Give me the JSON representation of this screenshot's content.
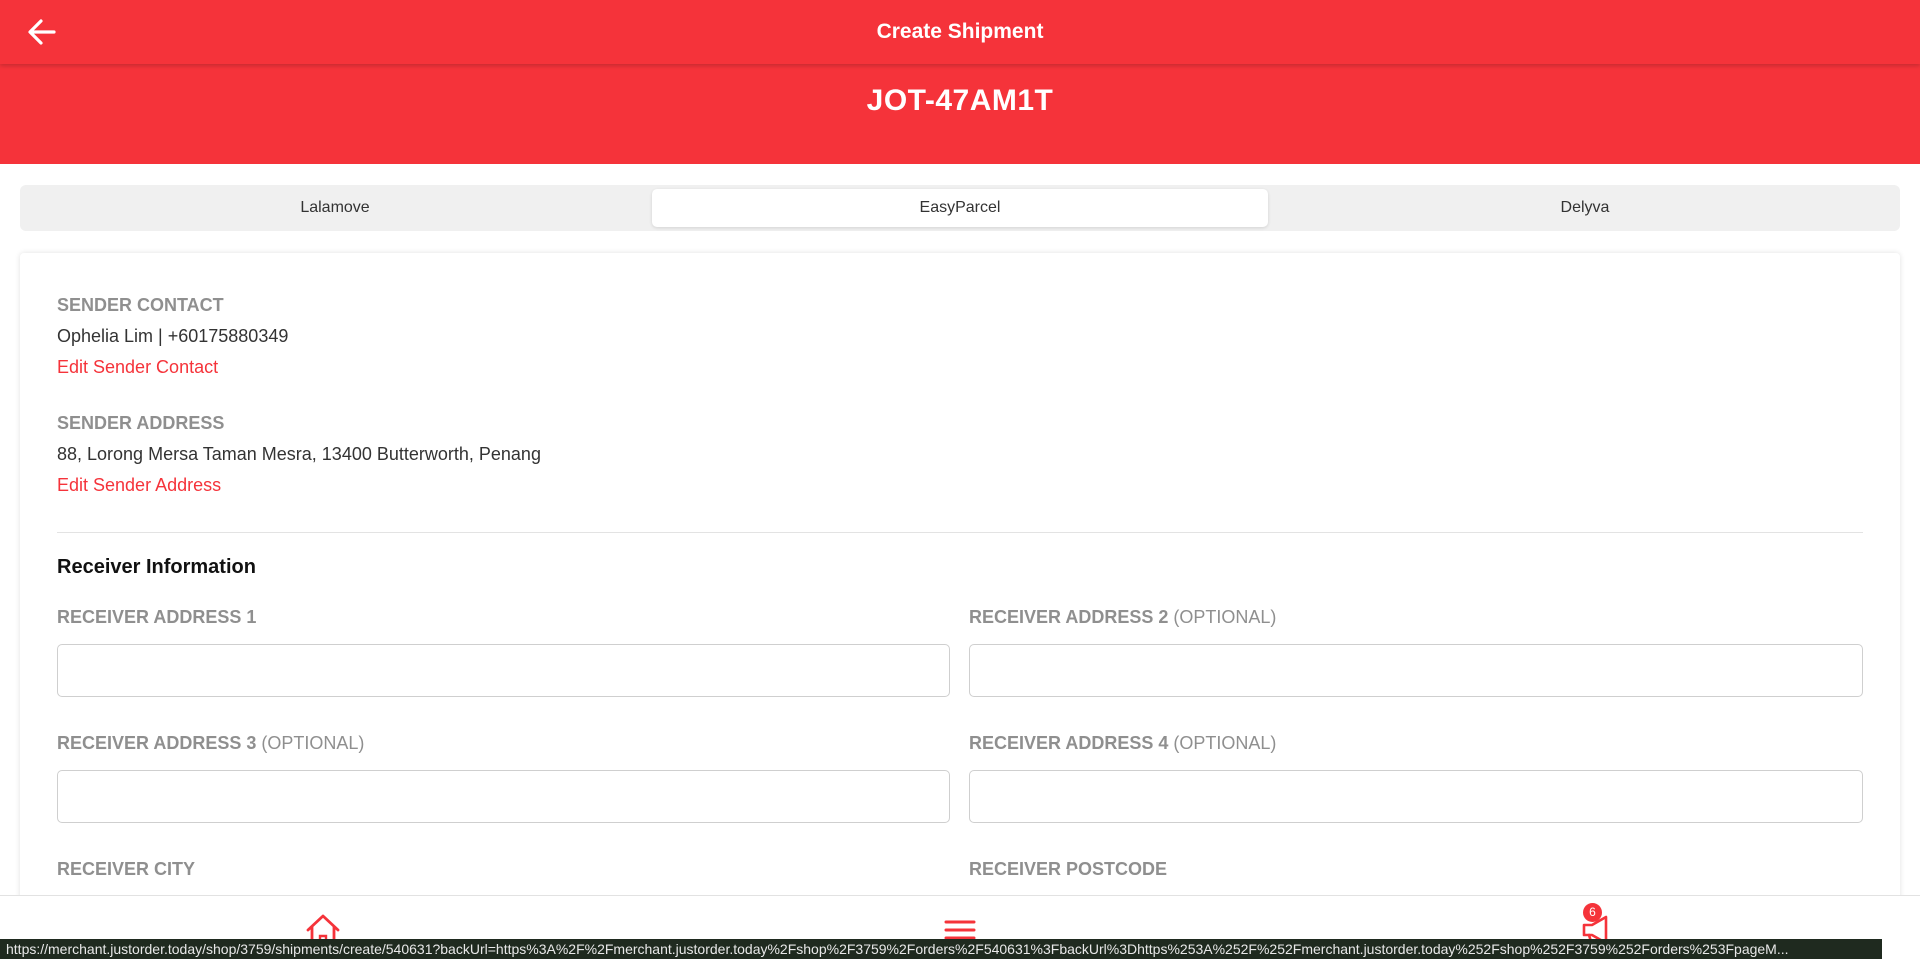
{
  "header": {
    "title": "Create Shipment",
    "order_code": "JOT-47AM1T"
  },
  "tabs": [
    {
      "label": "Lalamove",
      "active": false
    },
    {
      "label": "EasyParcel",
      "active": true
    },
    {
      "label": "Delyva",
      "active": false
    }
  ],
  "sender": {
    "contact_label": "SENDER CONTACT",
    "contact_value": "Ophelia Lim | +60175880349",
    "edit_contact_link": "Edit Sender Contact",
    "address_label": "SENDER ADDRESS",
    "address_value": "88, Lorong Mersa Taman Mesra, 13400 Butterworth, Penang",
    "edit_address_link": "Edit Sender Address"
  },
  "receiver": {
    "section_title": "Receiver Information",
    "address1": {
      "label": "RECEIVER ADDRESS 1",
      "optional": "",
      "value": ""
    },
    "address2": {
      "label": "RECEIVER ADDRESS 2",
      "optional": "(OPTIONAL)",
      "value": ""
    },
    "address3": {
      "label": "RECEIVER ADDRESS 3",
      "optional": "(OPTIONAL)",
      "value": ""
    },
    "address4": {
      "label": "RECEIVER ADDRESS 4",
      "optional": "(OPTIONAL)",
      "value": ""
    },
    "city_label": "RECEIVER CITY",
    "postcode_label": "RECEIVER POSTCODE"
  },
  "bottom_nav": {
    "items": [
      {
        "name": "home",
        "icon": "home-icon"
      },
      {
        "name": "menu",
        "icon": "menu-icon"
      },
      {
        "name": "announcements",
        "icon": "megaphone-icon"
      }
    ],
    "badge_count": "6"
  },
  "status_url": "https://merchant.justorder.today/shop/3759/shipments/create/540631?backUrl=https%3A%2F%2Fmerchant.justorder.today%2Fshop%2F3759%2Forders%2F540631%3FbackUrl%3Dhttps%253A%252F%252Fmerchant.justorder.today%252Fshop%252F3759%252Forders%253FpageM...",
  "colors": {
    "brand": "#f5333a",
    "label": "#8f8f8f"
  }
}
